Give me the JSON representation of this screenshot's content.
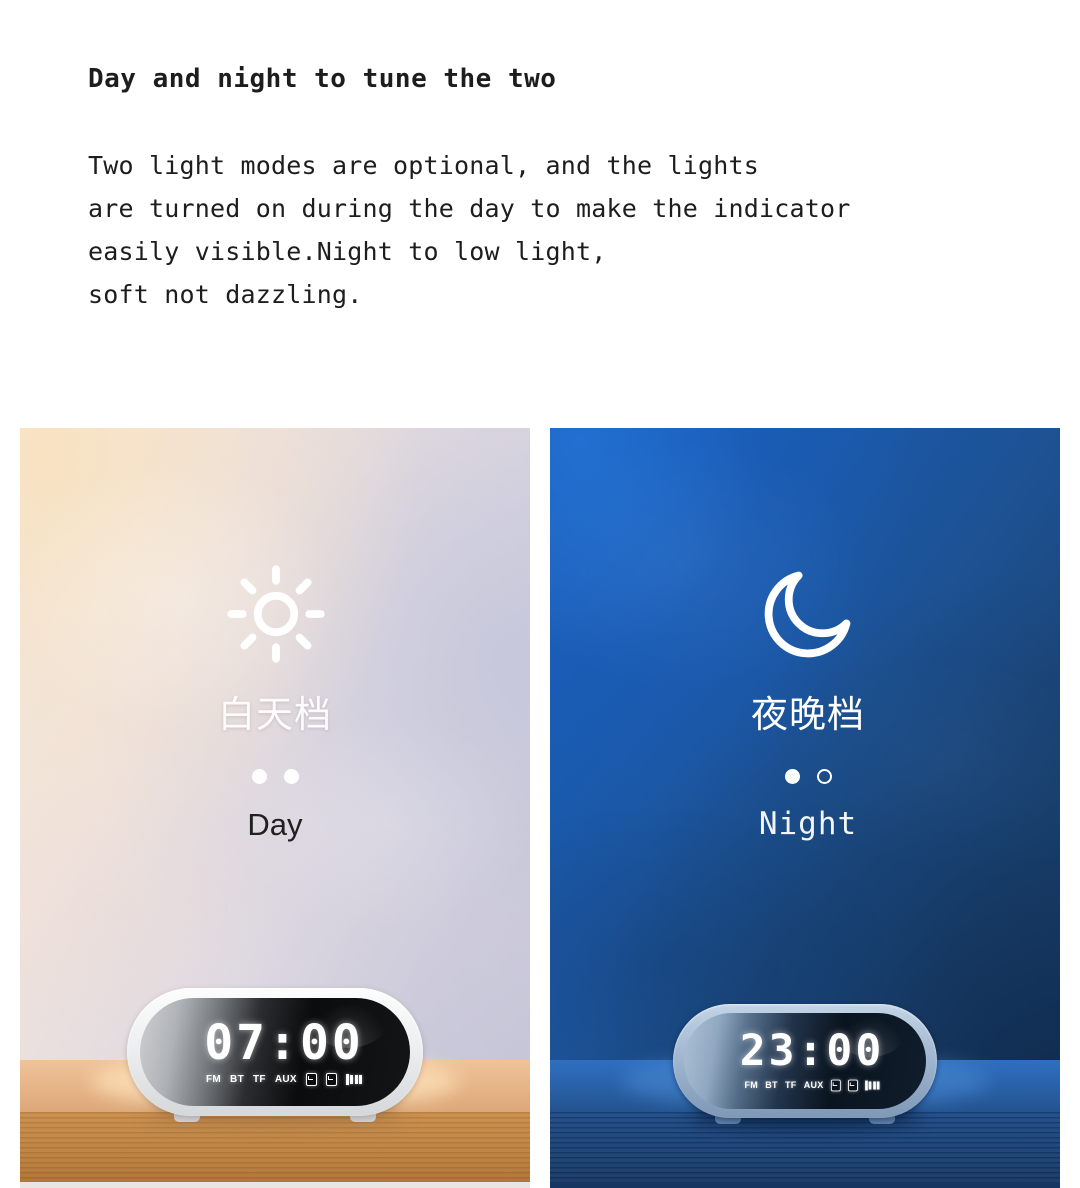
{
  "copy": {
    "headline": "Day and night to tune the two",
    "paragraph_lines": [
      "Two light modes are optional, and the lights",
      "are turned on during the day to make the indicator",
      "easily visible.Night to low light,",
      "soft not dazzling."
    ]
  },
  "panels": [
    {
      "mode": "day",
      "icon": "sun-icon",
      "label_cn": "白天档",
      "label_en": "Day",
      "dots": [
        "filled",
        "filled"
      ],
      "device": {
        "time": "07:00",
        "indicators": [
          "FM",
          "BT",
          "TF",
          "AUX"
        ],
        "alarm_icons": 2,
        "battery_bars": 4
      },
      "colors": {
        "bg_start": "#f7e9d6",
        "bg_end": "#c2c3d6",
        "label_en_color": "#20201f",
        "desk_top": "#e8b88c",
        "desk_edge": "#bb7f3c"
      }
    },
    {
      "mode": "night",
      "icon": "moon-icon",
      "label_cn": "夜晚档",
      "label_en": "Night",
      "dots": [
        "filled",
        "hollow"
      ],
      "device": {
        "time": "23:00",
        "indicators": [
          "FM",
          "BT",
          "TF",
          "AUX"
        ],
        "alarm_icons": 2,
        "battery_bars": 4
      },
      "colors": {
        "bg_start": "#1a62c0",
        "bg_end": "#1b3a62",
        "label_en_color": "#f2f4f7",
        "desk_top": "#2a63ac",
        "desk_edge": "#194072"
      }
    }
  ]
}
